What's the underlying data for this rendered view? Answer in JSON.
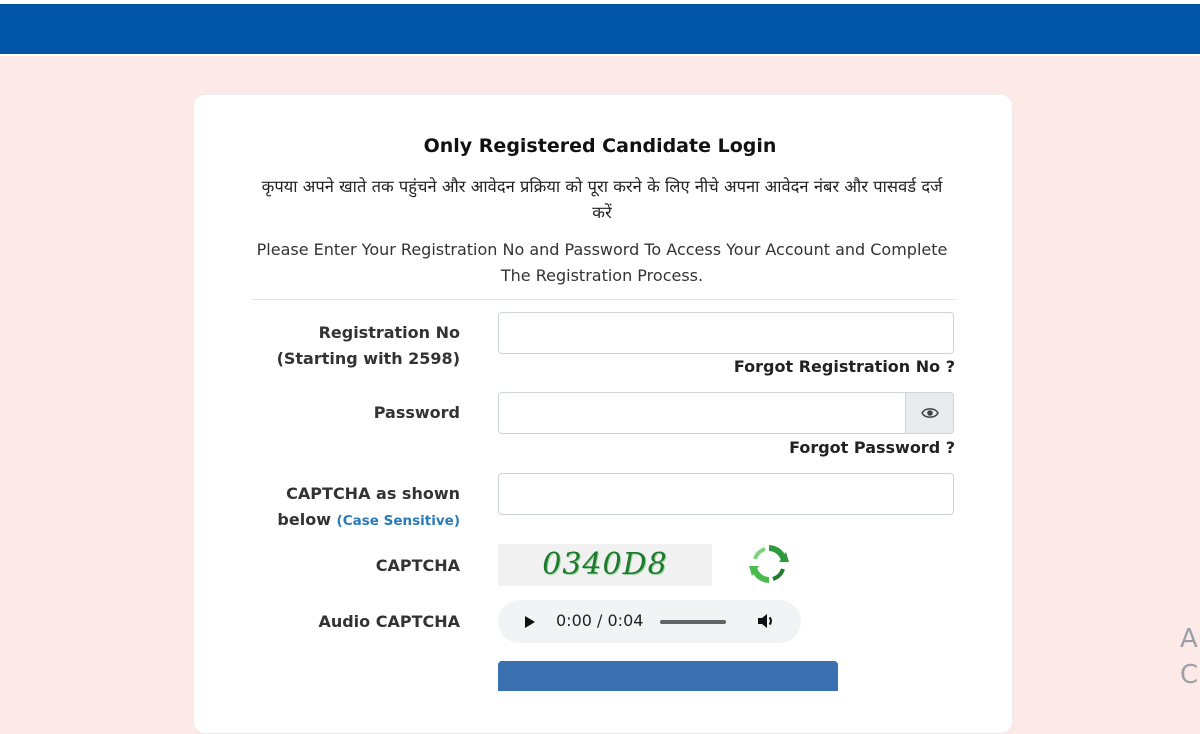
{
  "login": {
    "title": "Only Registered Candidate Login",
    "hindi_instruction": "कृपया अपने खाते तक पहुंचने और आवेदन प्रक्रिया को पूरा करने के लिए नीचे अपना आवेदन नंबर और पासवर्ड दर्ज करें",
    "english_instruction": "Please Enter Your Registration No and Password To Access Your Account and Complete The Registration Process."
  },
  "form": {
    "registration_label_line1": "Registration No",
    "registration_label_line2": "(Starting with 2598)",
    "registration_value": "",
    "forgot_registration": "Forgot Registration No ?",
    "password_label": "Password",
    "password_value": "",
    "forgot_password": "Forgot Password ?",
    "captcha_input_label_line1": "CAPTCHA as shown",
    "captcha_input_label_line2": "below",
    "captcha_input_hint": "(Case Sensitive)",
    "captcha_value": "",
    "captcha_label": "CAPTCHA",
    "captcha_image_text": "0340D8",
    "audio_captcha_label": "Audio CAPTCHA",
    "audio_time": "0:00 / 0:04"
  },
  "edge": {
    "char1": "A",
    "char2": "C"
  },
  "colors": {
    "header": "#0055a8",
    "background": "#fde9e7",
    "hint": "#2a7ab9",
    "captcha": "#1d7a2c"
  }
}
